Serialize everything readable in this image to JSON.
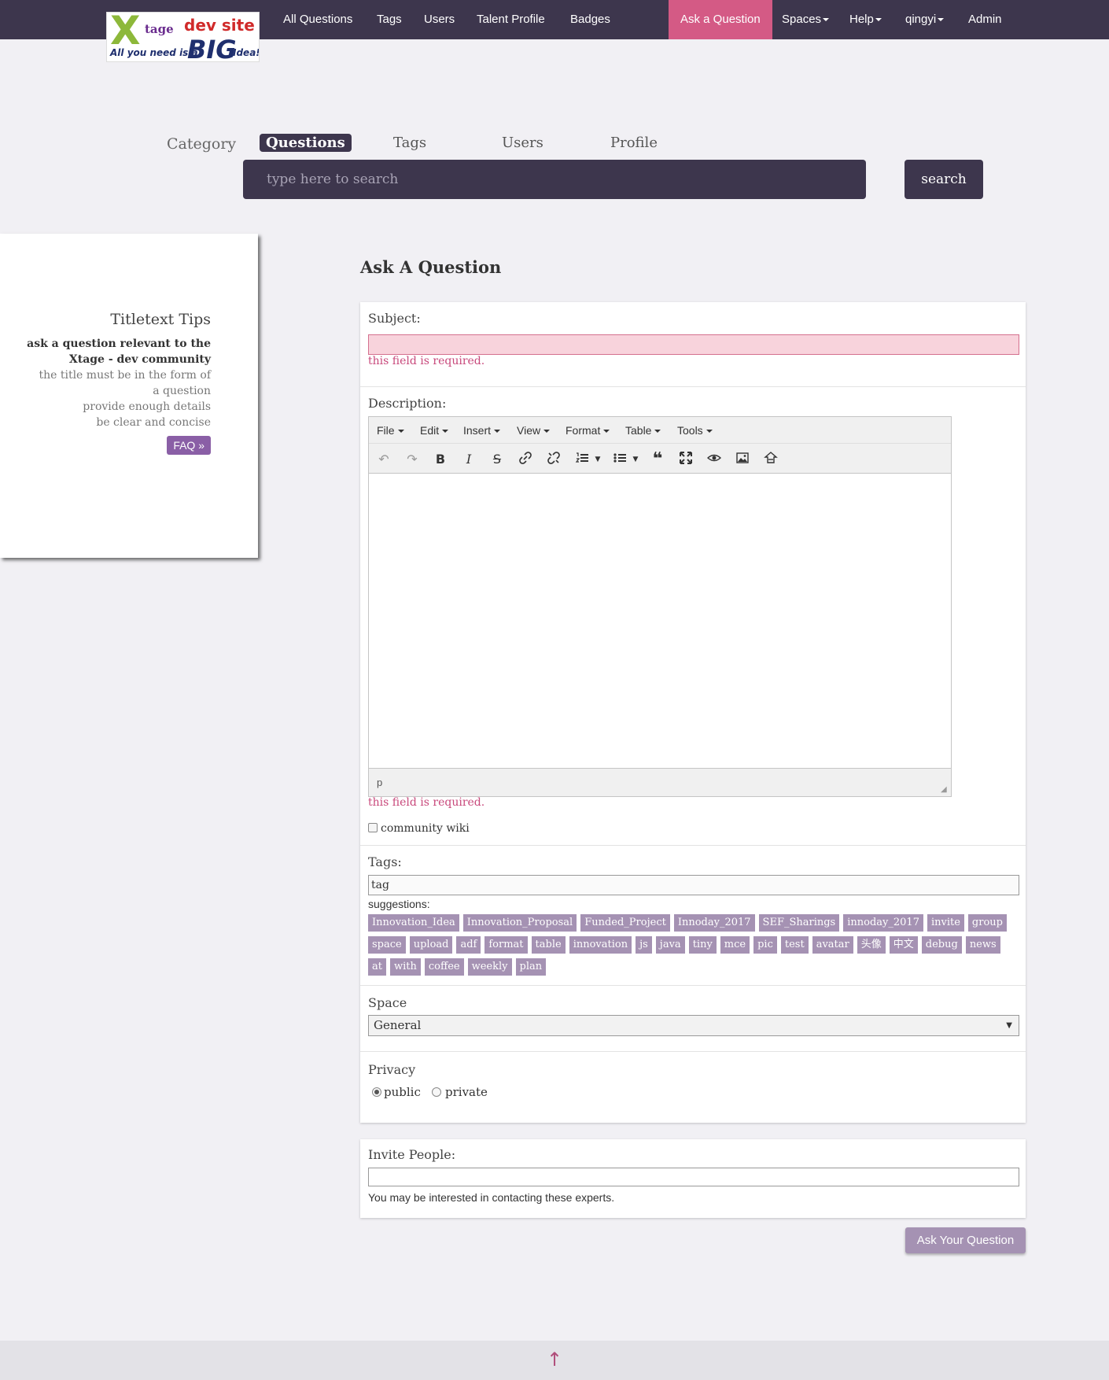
{
  "logo": {
    "letter": "X",
    "suffix": "tage",
    "site": "dev site",
    "slogan_start": "All you need is a",
    "slogan_big": "BIG",
    "slogan_end": "Idea!"
  },
  "nav": {
    "links": [
      "All Questions",
      "Tags",
      "Users",
      "Talent Profile",
      "Badges"
    ],
    "ask": "Ask a Question",
    "spaces": "Spaces",
    "help": "Help",
    "user": "qingyi",
    "admin": "Admin"
  },
  "search": {
    "category_label": "Category",
    "tabs": [
      "Questions",
      "Tags",
      "Users",
      "Profile"
    ],
    "placeholder": "type here to search",
    "button": "search"
  },
  "tips": {
    "title": "Titletext Tips",
    "lines": [
      "ask a question relevant to the Xtage - dev community",
      "the title must be in the form of a question",
      "provide enough details",
      "be clear and concise"
    ],
    "faq": "FAQ »"
  },
  "form": {
    "page_title": "Ask A Question",
    "subject_label": "Subject:",
    "required_msg": "this field is required.",
    "description_label": "Description:",
    "editor": {
      "menus": [
        "File",
        "Edit",
        "Insert",
        "View",
        "Format",
        "Table",
        "Tools"
      ],
      "status_path": "p"
    },
    "wiki_label": "community wiki",
    "tags_label": "Tags:",
    "tags_value": "tag",
    "suggestions_label": "suggestions:",
    "suggestions": [
      "Innovation_Idea",
      "Innovation_Proposal",
      "Funded_Project",
      "Innoday_2017",
      "SEF_Sharings",
      "innoday_2017",
      "invite",
      "group",
      "space",
      "upload",
      "adf",
      "format",
      "table",
      "innovation",
      "js",
      "java",
      "tiny",
      "mce",
      "pic",
      "test",
      "avatar",
      "头像",
      "中文",
      "debug",
      "news",
      "at",
      "with",
      "coffee",
      "weekly",
      "plan"
    ],
    "space_label": "Space",
    "space_value": "General",
    "privacy_label": "Privacy",
    "privacy_options": [
      "public",
      "private"
    ],
    "privacy_selected": "public",
    "invite_label": "Invite People:",
    "invite_note": "You may be interested in contacting these experts.",
    "submit": "Ask Your Question"
  },
  "colors": {
    "nav_bg": "#3d364d",
    "accent": "#d45a85",
    "chip": "#a592b3",
    "error": "#c8487b"
  }
}
